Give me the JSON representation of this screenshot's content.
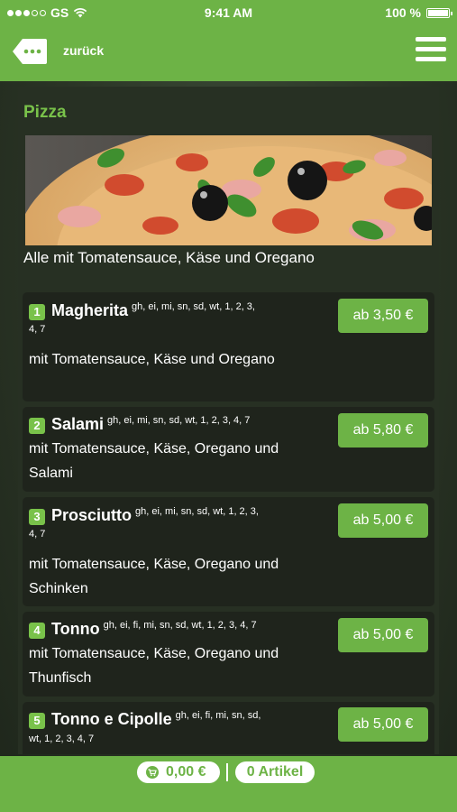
{
  "status": {
    "carrier": "GS",
    "time": "9:41 AM",
    "battery": "100 %"
  },
  "nav": {
    "back_label": "zurück"
  },
  "category": {
    "title": "Pizza",
    "description": "Alle mit Tomatensauce, Käse und Oregano"
  },
  "items": [
    {
      "num": "1",
      "name": "Magherita",
      "allergens": "gh, ei, mi, sn, sd, wt, 1, 2, 3,",
      "allergens2": "4, 7",
      "desc": "mit Tomatensauce, Käse und Oregano",
      "price": "ab 3,50 €"
    },
    {
      "num": "2",
      "name": "Salami",
      "allergens": "gh, ei, mi, sn, sd, wt, 1, 2, 3, 4, 7",
      "allergens2": "",
      "desc": "mit Tomatensauce, Käse, Oregano und Salami",
      "price": "ab 5,80 €"
    },
    {
      "num": "3",
      "name": "Prosciutto",
      "allergens": "gh, ei, mi, sn, sd, wt, 1, 2, 3,",
      "allergens2": "4, 7",
      "desc": "mit Tomatensauce, Käse, Oregano und Schinken",
      "price": "ab 5,00 €"
    },
    {
      "num": "4",
      "name": "Tonno",
      "allergens": "gh, ei, fi, mi, sn, sd, wt, 1, 2, 3, 4, 7",
      "allergens2": "",
      "desc": "mit Tomatensauce, Käse, Oregano und Thunfisch",
      "price": "ab 5,00 €"
    },
    {
      "num": "5",
      "name": "Tonno e Cipolle",
      "allergens": "gh, ei, fi, mi, sn, sd,",
      "allergens2": "wt, 1, 2, 3, 4, 7",
      "desc": "",
      "price": "ab 5,00 €"
    }
  ],
  "cart": {
    "total": "0,00 €",
    "count": "0 Artikel"
  },
  "colors": {
    "accent": "#6db346",
    "label_green": "#79c24a",
    "panel": "#273023",
    "card": "#1f241c"
  }
}
